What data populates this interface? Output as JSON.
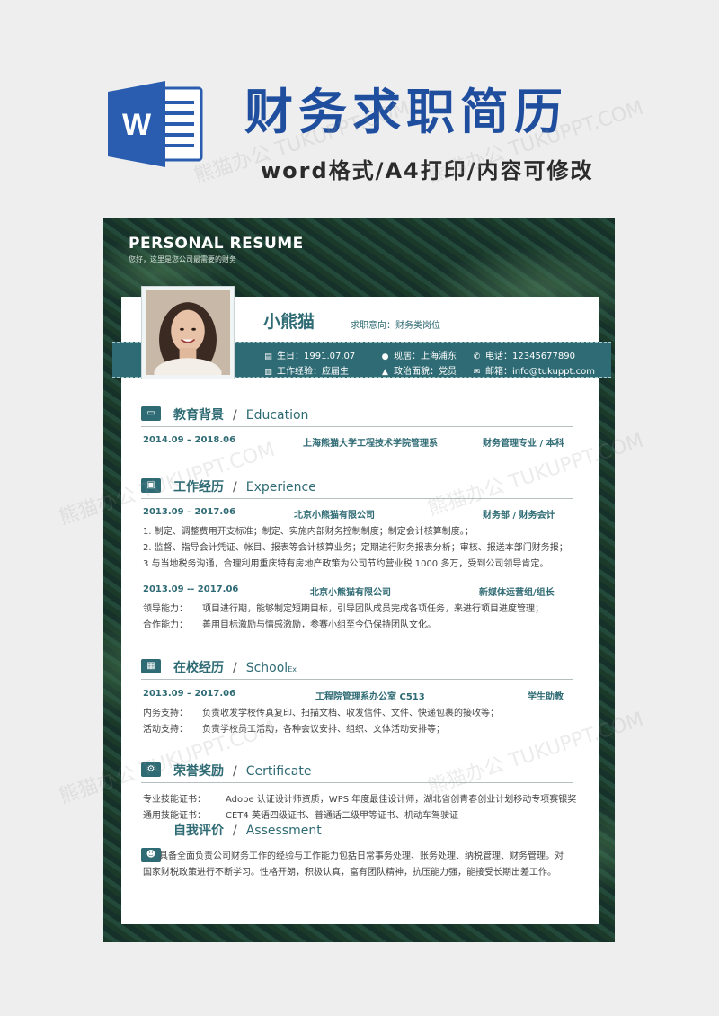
{
  "banner": {
    "title": "财务求职简历",
    "subtitle": "word格式/A4打印/内容可修改",
    "logo_letter": "W",
    "watermark": "熊猫办公 TUKUPPT.COM"
  },
  "resume": {
    "header_title": "PERSONAL RESUME",
    "header_sub": "您好，这里是您公司最需要的财务",
    "name": "小熊猫",
    "intent": "求职意向：财务类岗位",
    "info": {
      "birth": "生日：1991.07.07",
      "location": "现居：上海浦东",
      "phone": "电话：12345677890",
      "experience": "工作经验：应届生",
      "politics": "政治面貌：党员",
      "email": "邮箱：info@tukuppt.com"
    },
    "education": {
      "title_cn": "教育背景",
      "title_en": "Education",
      "date": "2014.09 – 2018.06",
      "school": "上海熊猫大学工程技术学院管理系",
      "major": "财务管理专业 / 本科"
    },
    "experience": {
      "title_cn": "工作经历",
      "title_en": "Experience",
      "job1": {
        "date": "2013.09 – 2017.06",
        "company": "北京小熊猫有限公司",
        "role": "财务部 / 财务会计",
        "lines": [
          "1. 制定、调整费用开支标准；制定、实施内部财务控制制度；制定会计核算制度。；",
          "2. 监督、指导会计凭证、帐目、报表等会计核算业务；定期进行财务报表分析；审核、报送本部门财务报；",
          "3 与当地税务沟通，合理利用重庆特有房地产政策为公司节约营业税 1000 多万，受到公司领导肯定。"
        ]
      },
      "job2": {
        "date": "2013.09 -- 2017.06",
        "company": "北京小熊猫有限公司",
        "role": "新媒体运营组/组长",
        "l1_label": "领导能力：",
        "l1_text": "项目进行期，能够制定短期目标，引导团队成员完成各项任务，来进行项目进度管理；",
        "l2_label": "合作能力：",
        "l2_text": "善用目标激励与情感激励，参赛小组至今仍保持团队文化。"
      }
    },
    "school": {
      "title_cn": "在校经历",
      "title_en": "School",
      "title_en_small": "Ex",
      "date": "2013.09 – 2017.06",
      "org": "工程院管理系办公室 C513",
      "role": "学生助教",
      "l1_label": "内务支持：",
      "l1_text": "负责收发学校传真复印、扫描文档、收发信件、文件、快递包裹的接收等；",
      "l2_label": "活动支持：",
      "l2_text": "负责学校员工活动，各种会议安排、组织、文体活动安排等；"
    },
    "certificate": {
      "title_cn": "荣誉奖励",
      "title_en": "Certificate",
      "l1_label": "专业技能证书：",
      "l1_text": "Adobe 认证设计师资质，WPS 年度最佳设计师，湖北省创青春创业计划移动专项赛银奖",
      "l2_label": "通用技能证书：",
      "l2_text": "CET4 英语四级证书、普通话二级甲等证书、机动车驾驶证"
    },
    "assessment": {
      "title_cn": "自我评价",
      "title_en": "Assessment",
      "l1": "具备全面负责公司财务工作的经验与工作能力包括日常事务处理、账务处理、纳税管理、财务管理。对",
      "l2": "国家财税政策进行不断学习。性格开朗，积极认真，富有团队精神，抗压能力强，能接受长期出差工作。"
    }
  },
  "colors": {
    "accent": "#2f6b74",
    "banner_blue": "#1f4e9e"
  }
}
